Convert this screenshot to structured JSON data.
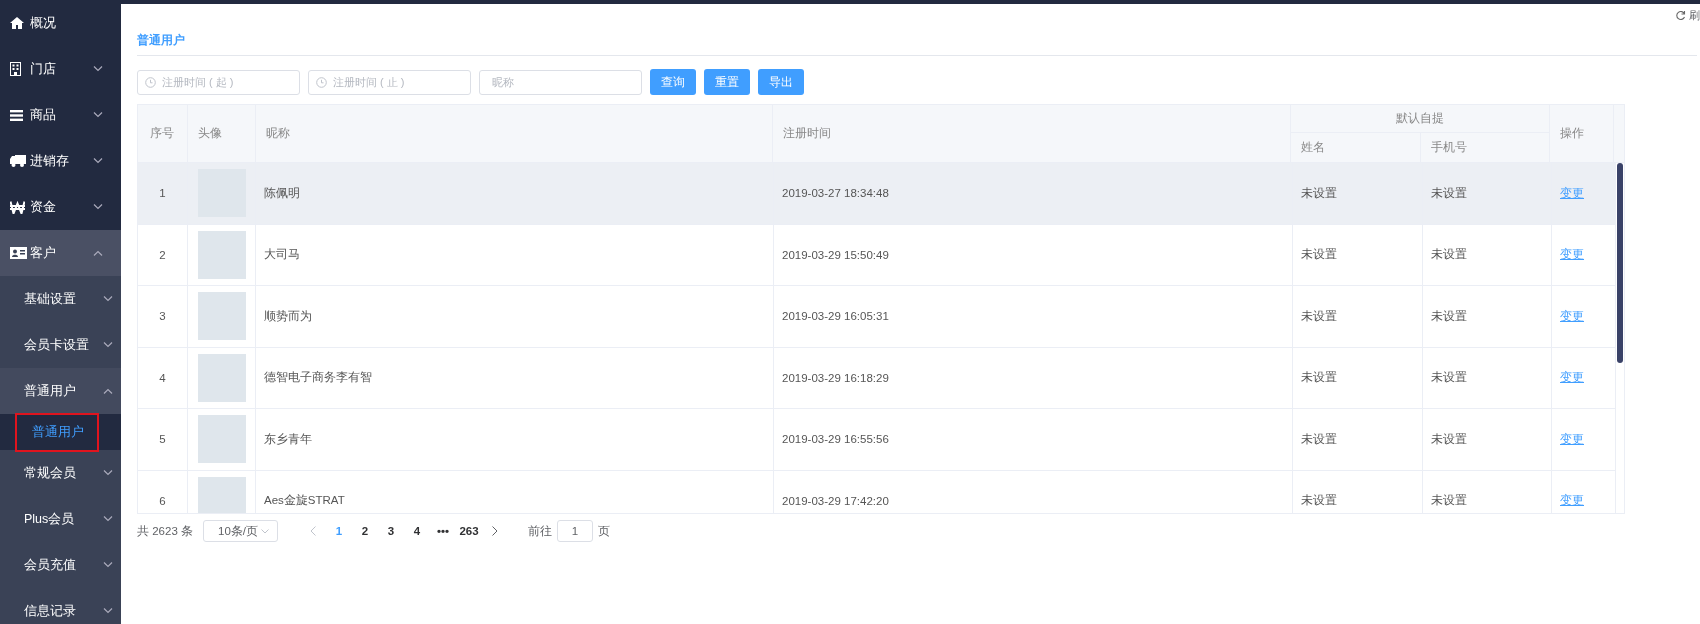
{
  "sidebar": {
    "items": [
      {
        "label": "概况"
      },
      {
        "label": "门店",
        "expanded": false
      },
      {
        "label": "商品",
        "expanded": false
      },
      {
        "label": "进销存",
        "expanded": false
      },
      {
        "label": "资金",
        "expanded": false
      },
      {
        "label": "客户",
        "expanded": true,
        "children": [
          {
            "label": "基础设置",
            "expanded": false
          },
          {
            "label": "会员卡设置",
            "expanded": false
          },
          {
            "label": "普通用户",
            "expanded": true,
            "children": [
              {
                "label": "普通用户",
                "selected": true
              }
            ]
          },
          {
            "label": "常规会员",
            "expanded": false
          },
          {
            "label": "Plus会员",
            "expanded": false
          },
          {
            "label": "会员充值",
            "expanded": false
          },
          {
            "label": "信息记录",
            "expanded": false
          }
        ]
      }
    ]
  },
  "refresh": {
    "label": "刷"
  },
  "page_title": "普通用户",
  "filters": {
    "start_date": {
      "placeholder": "注册时间 ( 起 )"
    },
    "end_date": {
      "placeholder": "注册时间 ( 止 )"
    },
    "nickname": {
      "placeholder": "昵称"
    },
    "buttons": [
      "查询",
      "重置",
      "导出"
    ]
  },
  "table": {
    "columns": {
      "index": "序号",
      "avatar": "头像",
      "nickname": "昵称",
      "registered": "注册时间",
      "group": "默认自提",
      "name": "姓名",
      "phone": "手机号",
      "action": "操作"
    },
    "rows": [
      {
        "index": "1",
        "nickname": "陈佩明",
        "registered": "2019-03-27 18:34:48",
        "name": "未设置",
        "phone": "未设置",
        "action": "变更",
        "hovered": true
      },
      {
        "index": "2",
        "nickname": "大司马",
        "registered": "2019-03-29 15:50:49",
        "name": "未设置",
        "phone": "未设置",
        "action": "变更",
        "hovered": false
      },
      {
        "index": "3",
        "nickname": "顺势而为",
        "registered": "2019-03-29 16:05:31",
        "name": "未设置",
        "phone": "未设置",
        "action": "变更",
        "hovered": false
      },
      {
        "index": "4",
        "nickname": "德智电子商务李有智",
        "registered": "2019-03-29 16:18:29",
        "name": "未设置",
        "phone": "未设置",
        "action": "变更",
        "hovered": false
      },
      {
        "index": "5",
        "nickname": "东乡青年",
        "registered": "2019-03-29 16:55:56",
        "name": "未设置",
        "phone": "未设置",
        "action": "变更",
        "hovered": false
      },
      {
        "index": "6",
        "nickname": "Aes金旋STRAT",
        "registered": "2019-03-29 17:42:20",
        "name": "未设置",
        "phone": "未设置",
        "action": "变更",
        "hovered": false
      }
    ]
  },
  "pagination": {
    "total": "共 2623 条",
    "page_size": "10条/页",
    "pages": [
      {
        "label": "1",
        "selected": true
      },
      {
        "label": "2",
        "selected": false
      },
      {
        "label": "3",
        "selected": false
      },
      {
        "label": "4",
        "selected": false
      },
      {
        "label": "•••",
        "selected": false
      },
      {
        "label": "263",
        "selected": false
      }
    ],
    "goto_label": "前往",
    "goto_value": "1",
    "goto_suffix": "页"
  }
}
